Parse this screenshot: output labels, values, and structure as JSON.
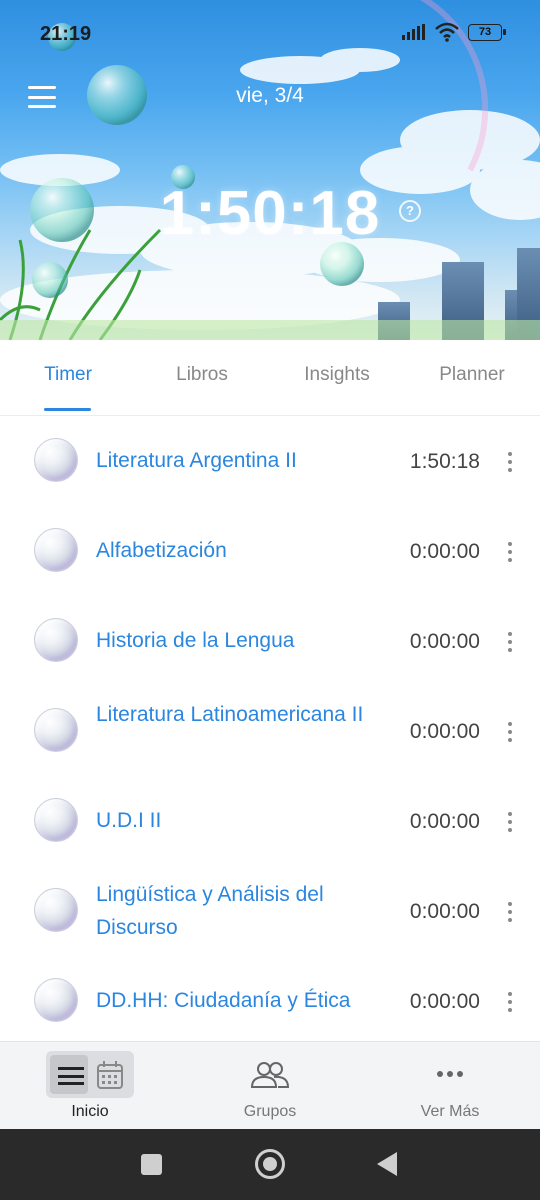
{
  "status_bar": {
    "time": "21:19",
    "battery": "73",
    "icons": [
      "signal-icon",
      "wifi-icon",
      "battery-icon"
    ]
  },
  "header": {
    "menu_icon": "hamburger-menu-icon",
    "date": "vie, 3/4",
    "timer": "1:50:18",
    "help_icon": "question-circle-icon"
  },
  "tabs": [
    {
      "label": "Timer",
      "active": true
    },
    {
      "label": "Libros",
      "active": false
    },
    {
      "label": "Insights",
      "active": false
    },
    {
      "label": "Planner",
      "active": false
    }
  ],
  "subjects": [
    {
      "name": "Literatura Argentina II",
      "time": "1:50:18"
    },
    {
      "name": "Alfabetización",
      "time": "0:00:00"
    },
    {
      "name": "Historia de la Lengua",
      "time": "0:00:00"
    },
    {
      "name": "Literatura Latinoamericana II",
      "time": "0:00:00"
    },
    {
      "name": "U.D.I II",
      "time": "0:00:00"
    },
    {
      "name": "Lingüística y Análisis del Discurso",
      "time": "0:00:00"
    },
    {
      "name": "DD.HH: Ciudadanía y Ética",
      "time": "0:00:00"
    }
  ],
  "bottom_nav": [
    {
      "label": "Inicio",
      "icon": "list-calendar-icon",
      "active": true
    },
    {
      "label": "Grupos",
      "icon": "people-icon",
      "active": false
    },
    {
      "label": "Ver Más",
      "icon": "more-horizontal-icon",
      "active": false
    }
  ],
  "colors": {
    "accent": "#2b86e0",
    "time_text": "#444444",
    "nav_bg": "#f3f4f6",
    "system_bar": "#2a2a2a"
  }
}
